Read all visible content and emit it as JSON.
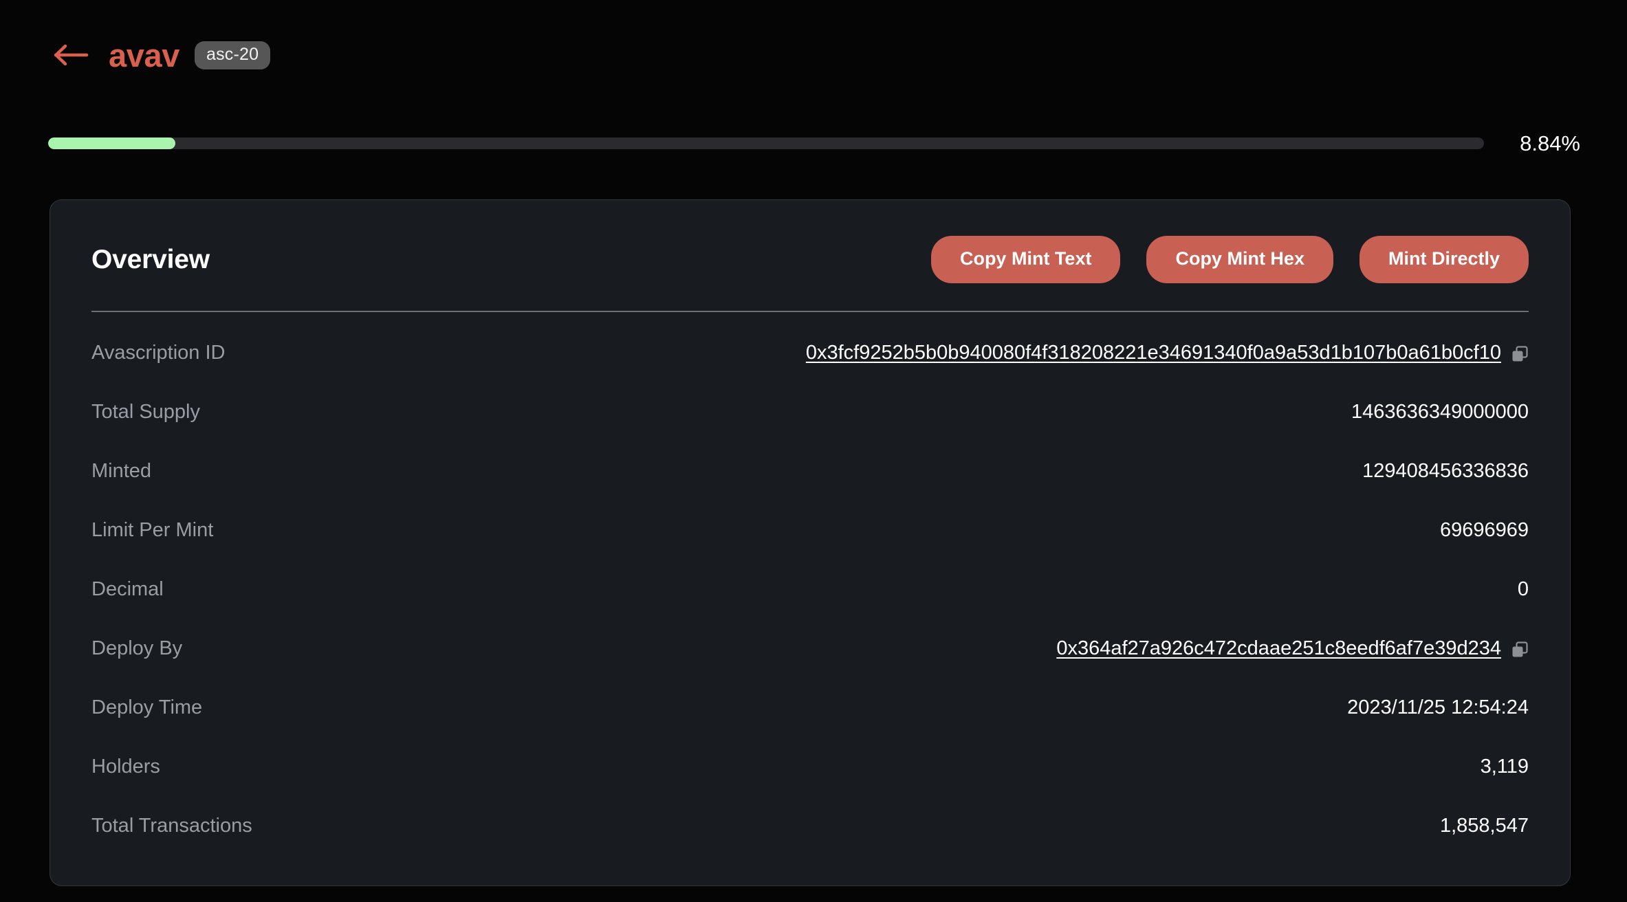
{
  "header": {
    "back_icon": "arrow-left-icon",
    "token_name": "avav",
    "standard_badge": "asc-20"
  },
  "progress": {
    "percent_label": "8.84%",
    "percent_value": 8.84,
    "fill_color": "#a9f5ad",
    "track_color": "#2b2b2d"
  },
  "card": {
    "title": "Overview",
    "buttons": [
      {
        "label": "Copy Mint Text",
        "name": "copy-mint-text-button"
      },
      {
        "label": "Copy Mint Hex",
        "name": "copy-mint-hex-button"
      },
      {
        "label": "Mint Directly",
        "name": "mint-directly-button"
      }
    ],
    "button_color": "#c86054",
    "rows": [
      {
        "label": "Avascription ID",
        "value": "0x3fcf9252b5b0b940080f4f318208221e34691340f0a9a53d1b107b0a61b0cf10",
        "is_link": true,
        "has_copy": true
      },
      {
        "label": "Total Supply",
        "value": "1463636349000000",
        "is_link": false,
        "has_copy": false
      },
      {
        "label": "Minted",
        "value": "129408456336836",
        "is_link": false,
        "has_copy": false
      },
      {
        "label": "Limit Per Mint",
        "value": "69696969",
        "is_link": false,
        "has_copy": false
      },
      {
        "label": "Decimal",
        "value": "0",
        "is_link": false,
        "has_copy": false
      },
      {
        "label": "Deploy By",
        "value": "0x364af27a926c472cdaae251c8eedf6af7e39d234",
        "is_link": true,
        "has_copy": true
      },
      {
        "label": "Deploy Time",
        "value": "2023/11/25 12:54:24",
        "is_link": false,
        "has_copy": false
      },
      {
        "label": "Holders",
        "value": "3,119",
        "is_link": false,
        "has_copy": false
      },
      {
        "label": "Total Transactions",
        "value": "1,858,547",
        "is_link": false,
        "has_copy": false
      }
    ]
  },
  "colors": {
    "page_background": "#050506",
    "card_background": "#181b20",
    "accent": "#d9604f",
    "label_text": "#9a9ea4",
    "value_text": "#ffffff"
  }
}
